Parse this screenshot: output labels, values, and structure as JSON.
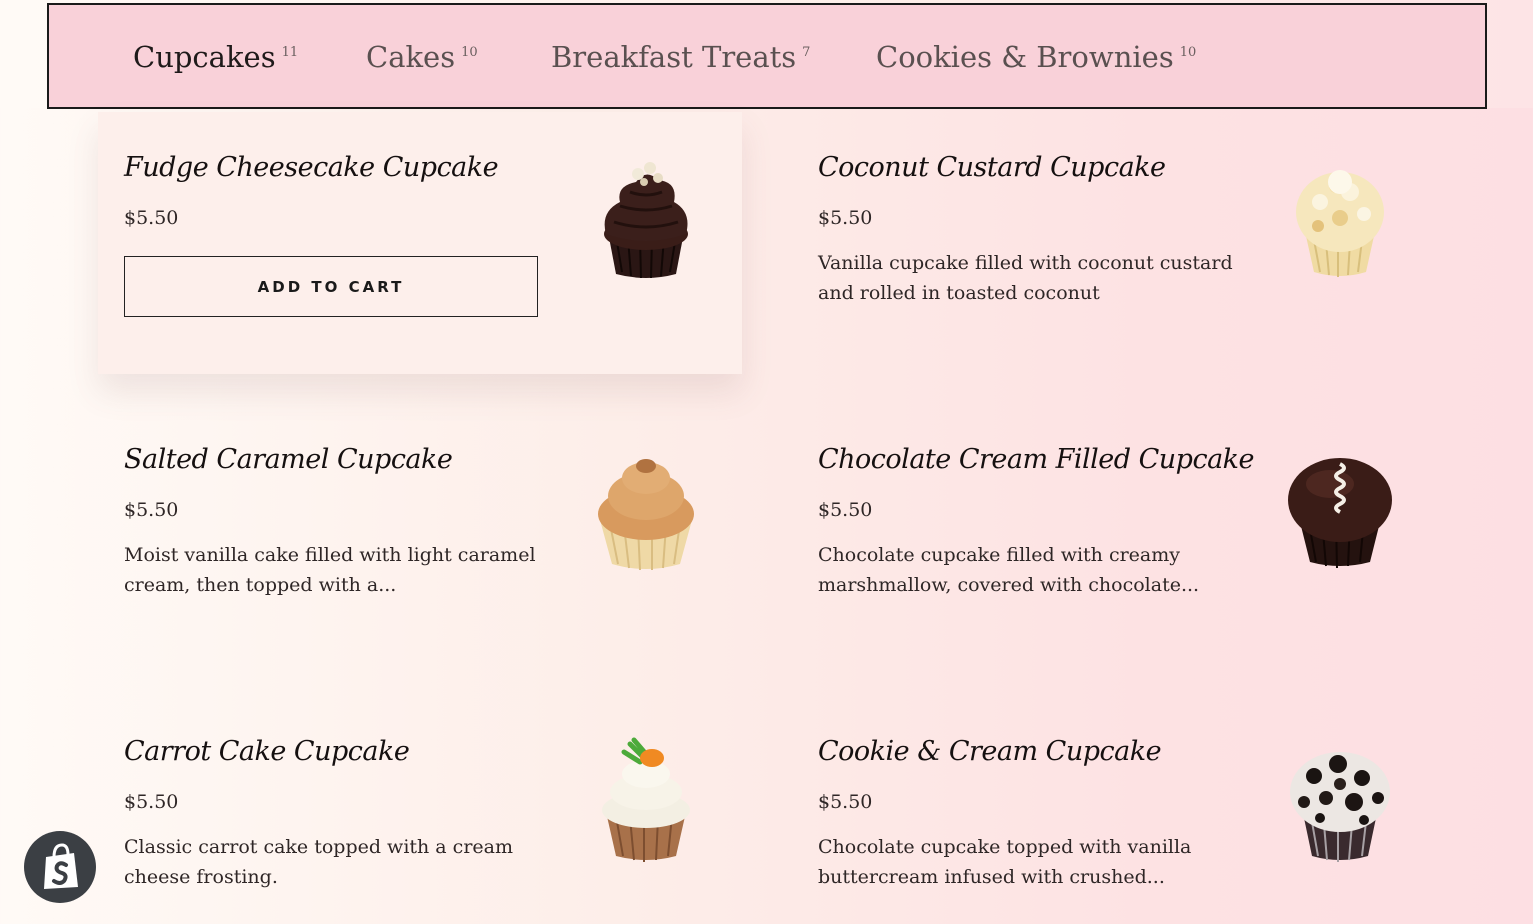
{
  "tabs": [
    {
      "label": "Cupcakes",
      "count": "11",
      "active": true
    },
    {
      "label": "Cakes",
      "count": "10",
      "active": false
    },
    {
      "label": "Breakfast Treats",
      "count": "7",
      "active": false
    },
    {
      "label": "Cookies & Brownies",
      "count": "10",
      "active": false
    }
  ],
  "products": [
    {
      "name": "Fudge Cheesecake Cupcake",
      "price": "$5.50",
      "description": "",
      "button": "ADD TO CART",
      "image": "chocolate-swirl-cupcake"
    },
    {
      "name": "Coconut Custard Cupcake",
      "price": "$5.50",
      "description": "Vanilla cupcake filled with coconut custard and rolled in toasted coconut",
      "image": "coconut-cupcake"
    },
    {
      "name": "Salted Caramel Cupcake",
      "price": "$5.50",
      "description": "Moist vanilla cake filled with light caramel cream, then topped with a...",
      "image": "caramel-cupcake"
    },
    {
      "name": "Chocolate Cream Filled Cupcake",
      "price": "$5.50",
      "description": "Chocolate cupcake filled with creamy marshmallow, covered with chocolate...",
      "image": "chocolate-cream-cupcake"
    },
    {
      "name": "Carrot Cake Cupcake",
      "price": "$5.50",
      "description": "Classic carrot cake topped with a cream cheese frosting.",
      "image": "carrot-cupcake"
    },
    {
      "name": "Cookie & Cream Cupcake",
      "price": "$5.50",
      "description": "Chocolate cupcake topped with vanilla buttercream infused with crushed...",
      "image": "cookies-cream-cupcake"
    }
  ],
  "colors": {
    "tabbar": "#f9d1d9",
    "accent": "#1a1a1a"
  },
  "badge": {
    "icon": "shopify-bag-icon"
  }
}
